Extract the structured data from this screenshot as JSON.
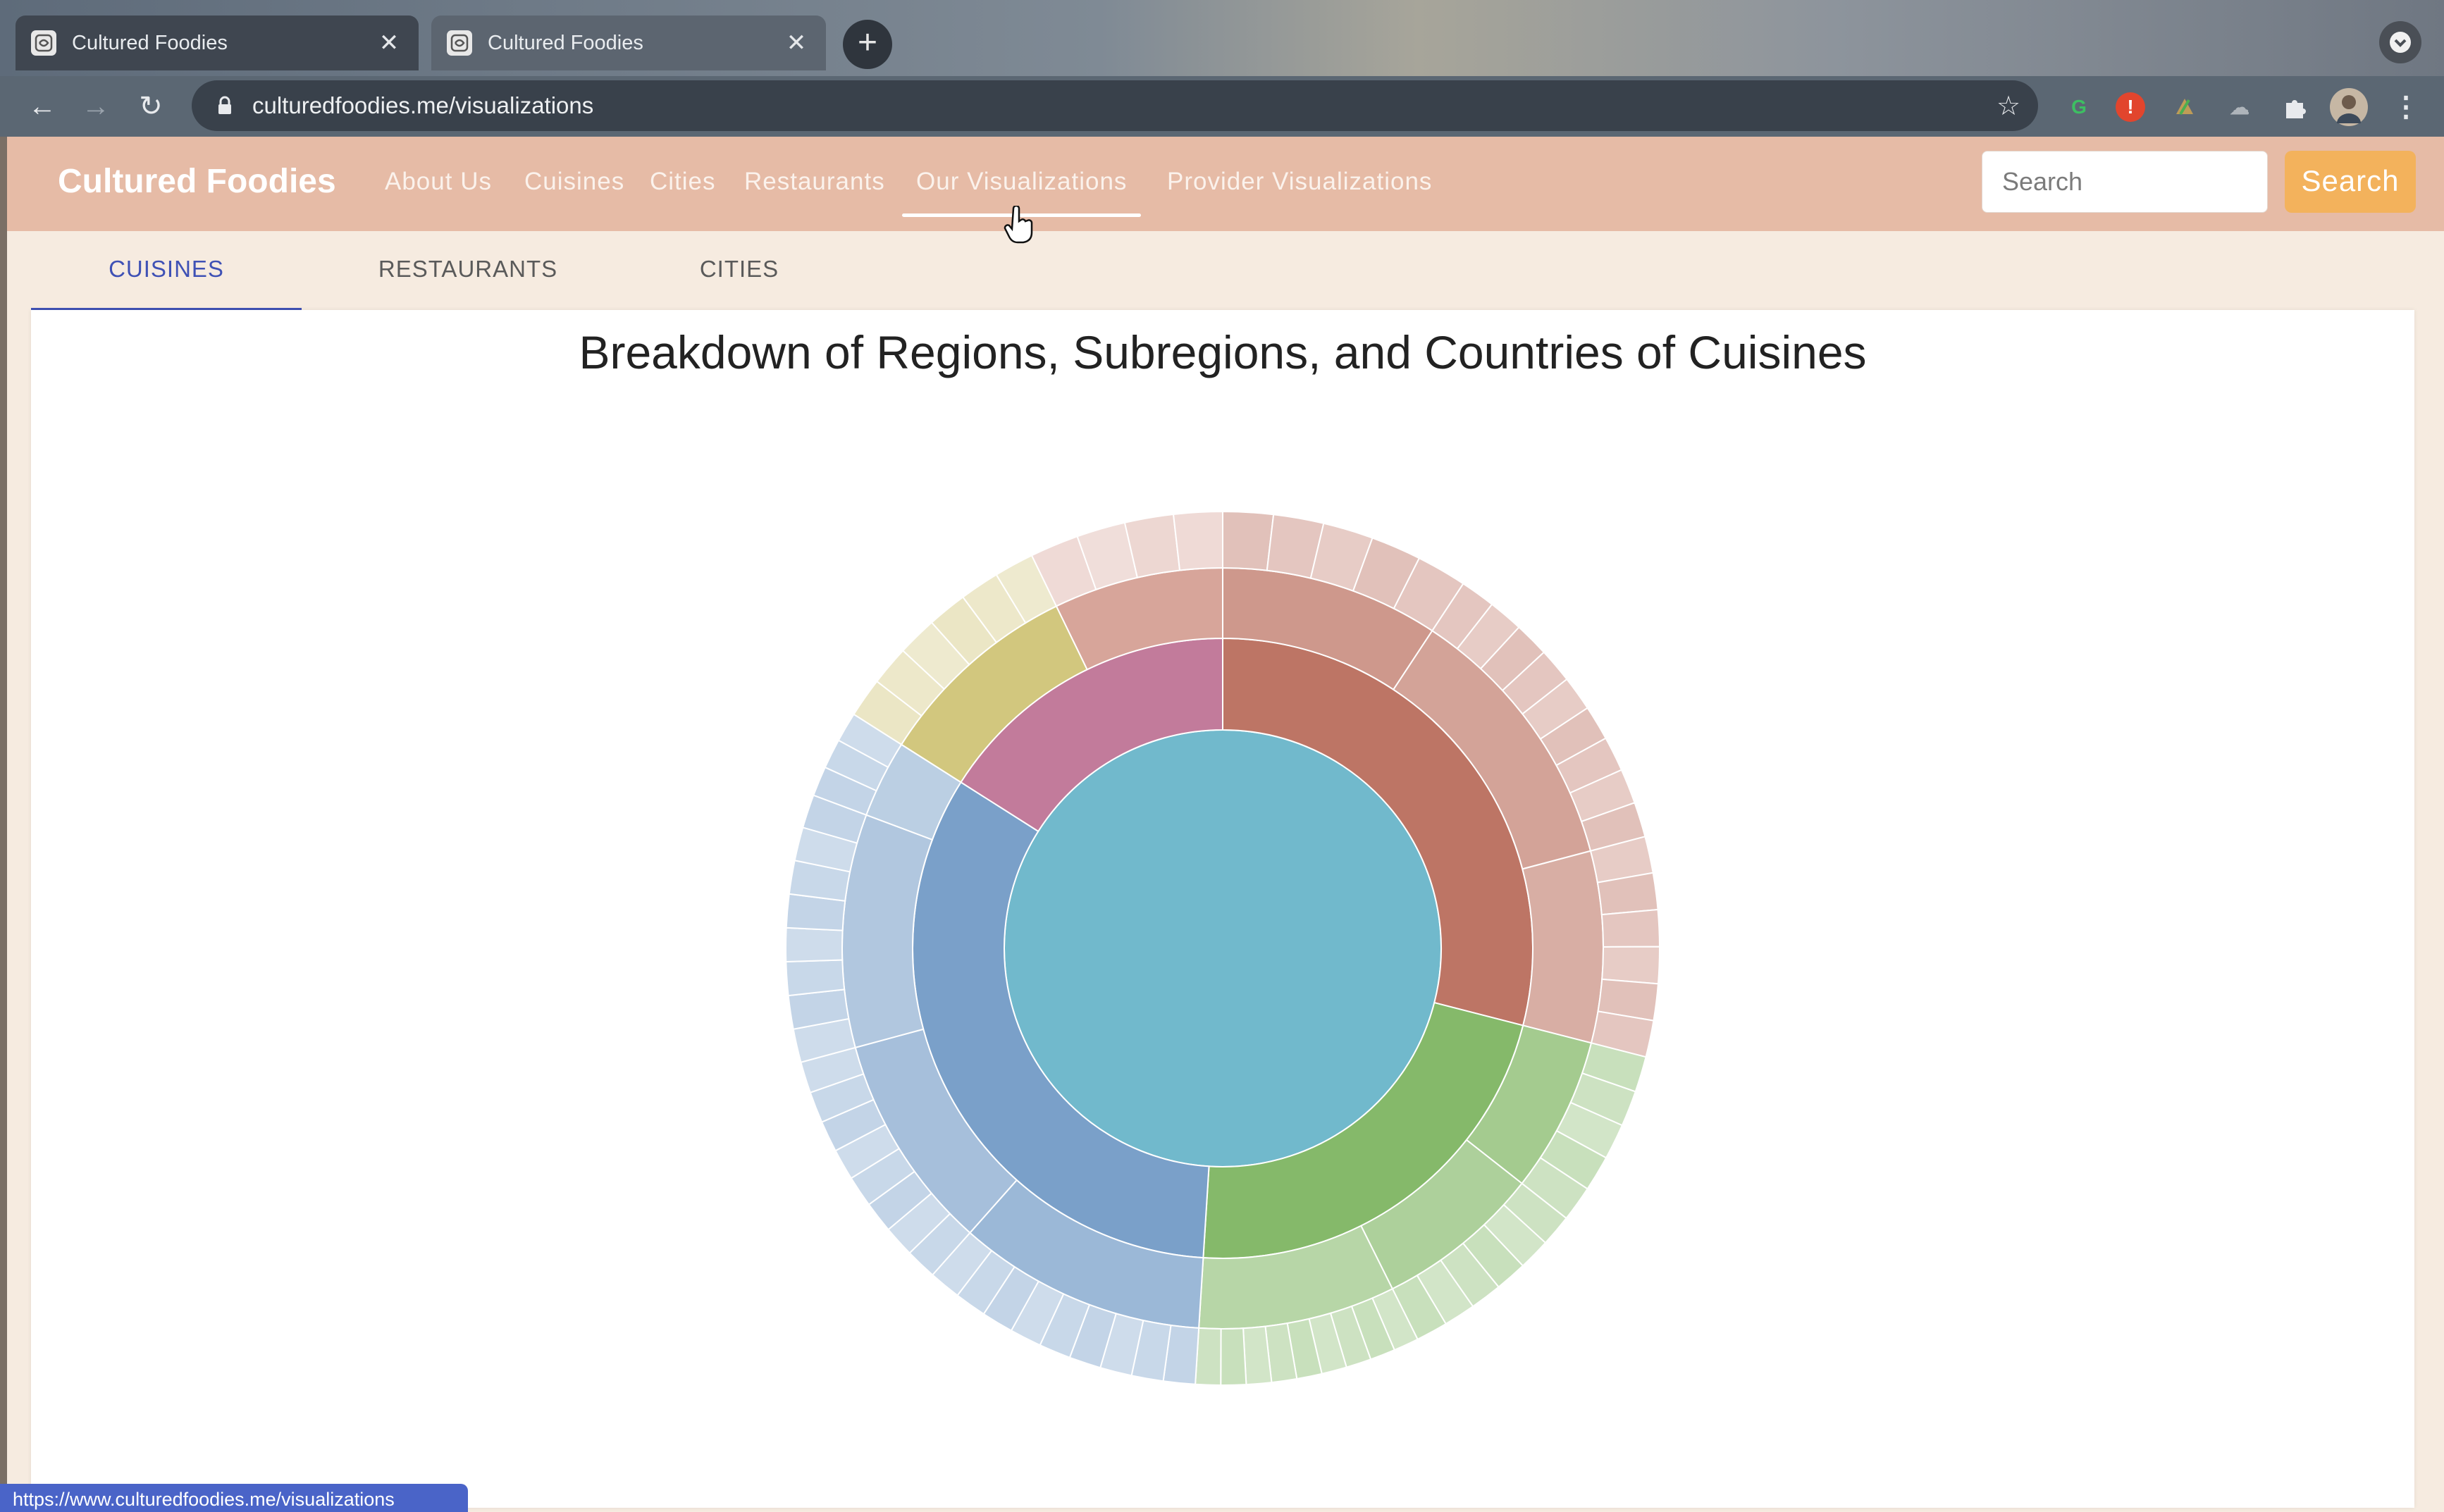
{
  "browser": {
    "tabs": [
      {
        "title": "Cultured Foodies"
      },
      {
        "title": "Cultured Foodies"
      }
    ],
    "url": "culturedfoodies.me/visualizations",
    "status_url": "https://www.culturedfoodies.me/visualizations"
  },
  "site": {
    "brand": "Cultured Foodies",
    "nav": [
      {
        "label": "About Us"
      },
      {
        "label": "Cuisines"
      },
      {
        "label": "Cities"
      },
      {
        "label": "Restaurants"
      },
      {
        "label": "Our Visualizations"
      },
      {
        "label": "Provider Visualizations"
      }
    ],
    "search_placeholder": "Search",
    "search_button": "Search"
  },
  "viz_tabs": [
    {
      "label": "CUISINES",
      "selected": true
    },
    {
      "label": "RESTAURANTS",
      "selected": false
    },
    {
      "label": "CITIES",
      "selected": false
    }
  ],
  "chart_data": {
    "type": "sunburst",
    "title": "Breakdown of Regions, Subregions, and Countries of Cuisines",
    "root_color": "#71b9cc",
    "regions": [
      {
        "color": "#bd7565",
        "share": 0.29,
        "subregions": [
          {
            "share": 0.32,
            "countries": 5
          },
          {
            "share": 0.4,
            "countries": 9
          },
          {
            "share": 0.28,
            "countries": 6
          }
        ]
      },
      {
        "color": "#85b96a",
        "share": 0.22,
        "subregions": [
          {
            "share": 0.3,
            "countries": 5
          },
          {
            "share": 0.32,
            "countries": 6
          },
          {
            "share": 0.38,
            "countries": 9
          }
        ]
      },
      {
        "color": "#7aa0c9",
        "share": 0.33,
        "subregions": [
          {
            "share": 0.32,
            "countries": 9
          },
          {
            "share": 0.28,
            "countries": 8
          },
          {
            "share": 0.3,
            "countries": 8
          },
          {
            "share": 0.1,
            "countries": 3
          }
        ]
      },
      {
        "color": "#c27b9b",
        "share": 0.16,
        "subregions": [
          {
            "share": 0.55,
            "countries": 6,
            "color": "#d2c77e"
          },
          {
            "share": 0.45,
            "countries": 4,
            "color": "#d7a59a"
          }
        ]
      }
    ]
  }
}
